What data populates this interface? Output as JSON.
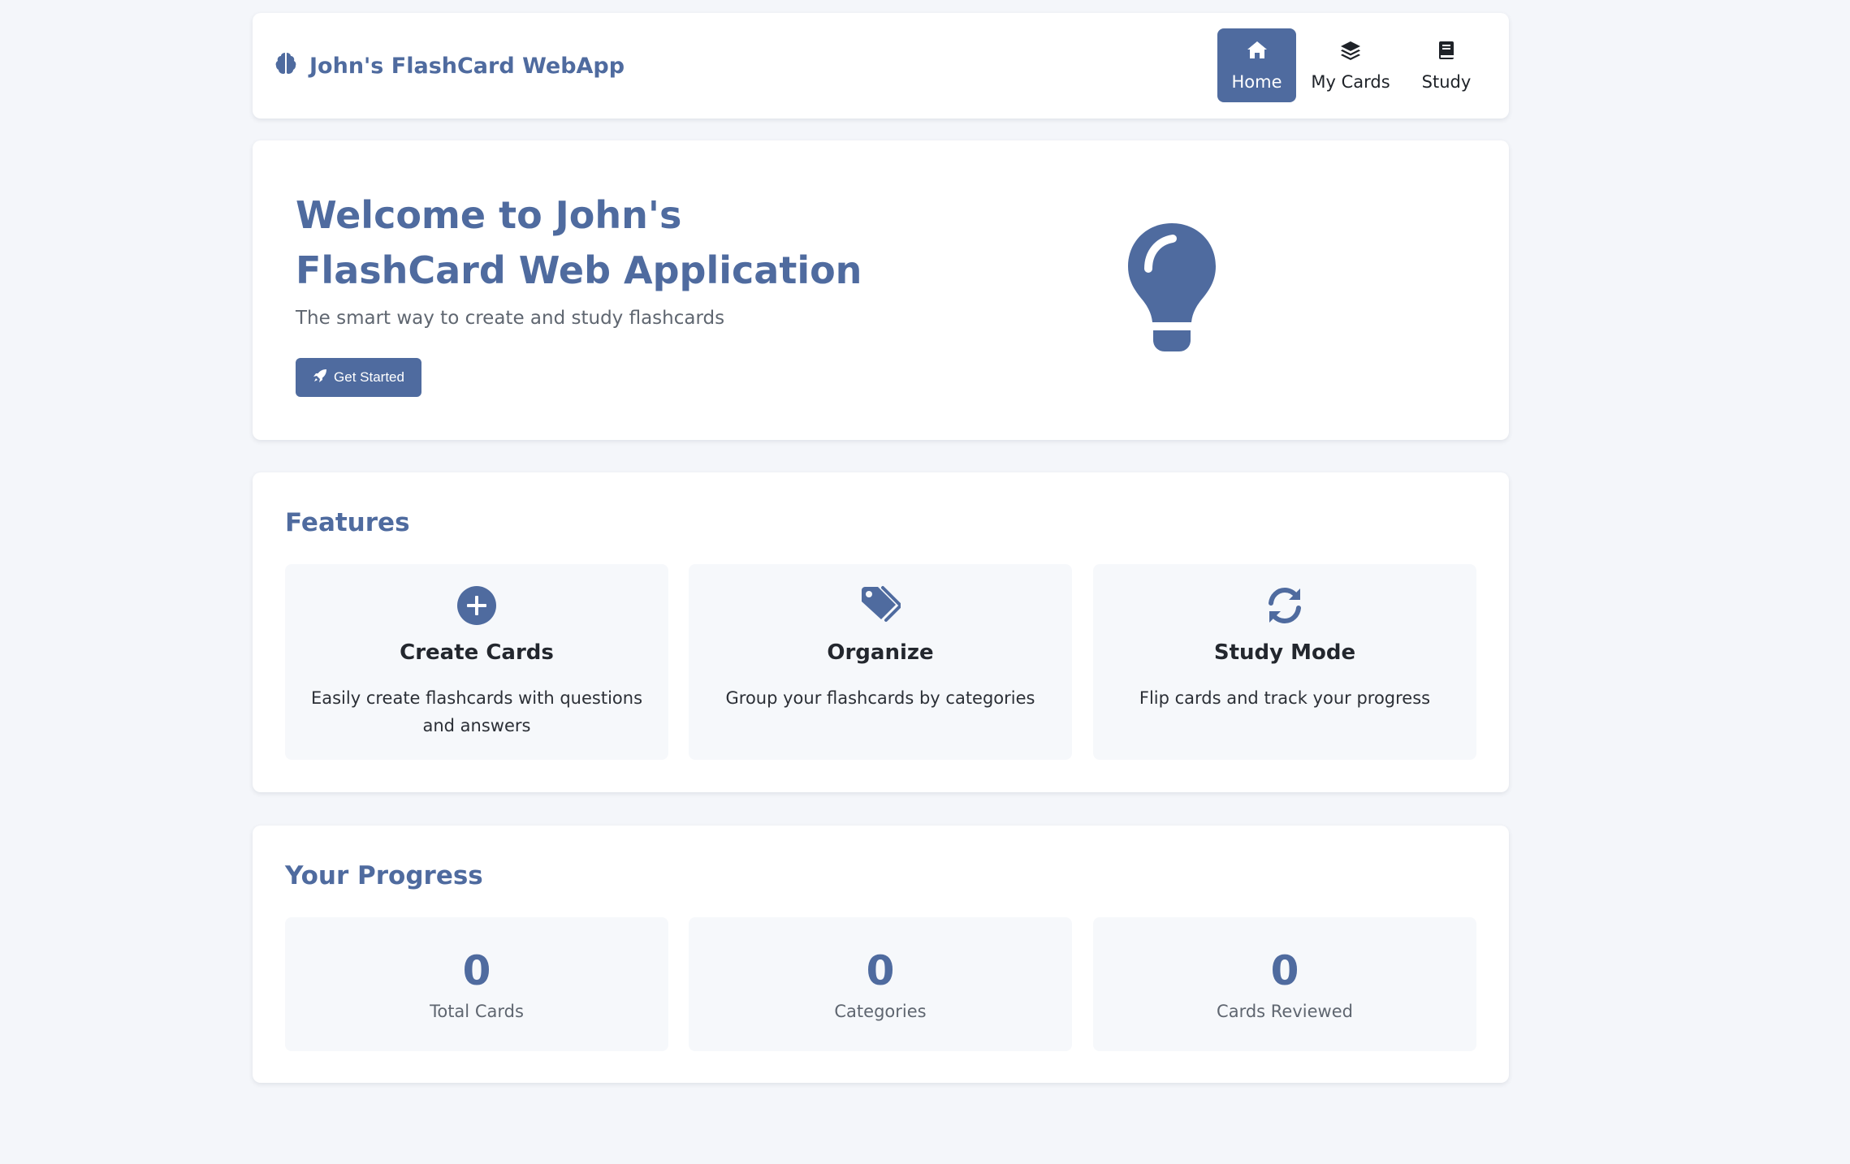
{
  "brand": {
    "name": "John's FlashCard WebApp",
    "icon": "brain-icon"
  },
  "nav": {
    "items": [
      {
        "label": "Home",
        "icon": "home-icon",
        "active": true
      },
      {
        "label": "My Cards",
        "icon": "layers-icon",
        "active": false
      },
      {
        "label": "Study",
        "icon": "book-icon",
        "active": false
      }
    ]
  },
  "hero": {
    "title": "Welcome to John's FlashCard Web Application",
    "subtitle": "The smart way to create and study flashcards",
    "button_label": "Get Started",
    "button_icon": "rocket-icon",
    "illustration_icon": "lightbulb-icon"
  },
  "features": {
    "title": "Features",
    "items": [
      {
        "icon": "plus-circle-icon",
        "title": "Create Cards",
        "description": "Easily create flashcards with questions and answers"
      },
      {
        "icon": "tags-icon",
        "title": "Organize",
        "description": "Group your flashcards by categories"
      },
      {
        "icon": "sync-icon",
        "title": "Study Mode",
        "description": "Flip cards and track your progress"
      }
    ]
  },
  "progress": {
    "title": "Your Progress",
    "stats": [
      {
        "value": "0",
        "label": "Total Cards"
      },
      {
        "value": "0",
        "label": "Categories"
      },
      {
        "value": "0",
        "label": "Cards Reviewed"
      }
    ]
  },
  "colors": {
    "accent": "#4f6b9f",
    "background": "#f4f6fa",
    "tile": "#f6f8fb"
  }
}
